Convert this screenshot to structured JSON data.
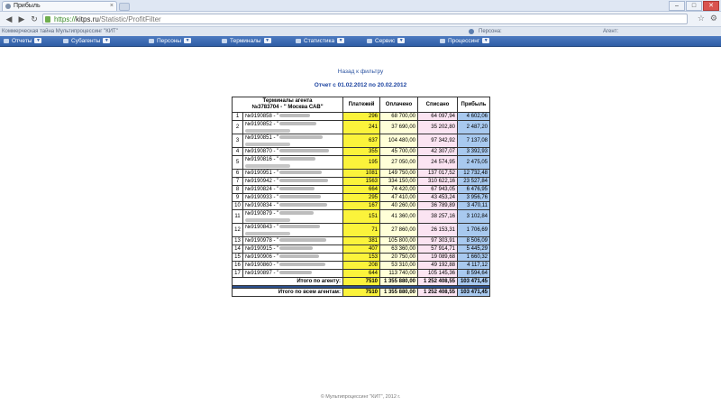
{
  "browser": {
    "tab_title": "Прибыль",
    "tab_close": "×",
    "url_scheme": "https://",
    "url_host": "kitps.ru",
    "url_path": "/Statistic/ProfitFilter",
    "window_minimize": "–",
    "window_maximize": "□",
    "window_close": "✕"
  },
  "site": {
    "company": "Коммерческая тайна Мультипроцессинг \"КИТ\"",
    "personal_label": "Персона:",
    "agent_label": "Агент:"
  },
  "menu": [
    {
      "label": "Отчеты",
      "icon": "report-icon"
    },
    {
      "label": "Субагенты",
      "icon": "subagents-icon"
    },
    {
      "label": "Персоны",
      "icon": "persons-icon"
    },
    {
      "label": "Терминалы",
      "icon": "terminals-icon"
    },
    {
      "label": "Статистика",
      "icon": "statistics-icon"
    },
    {
      "label": "Сервис",
      "icon": "service-icon"
    },
    {
      "label": "Процессинг",
      "icon": "processing-icon"
    }
  ],
  "page": {
    "back_link": "Назад к фильтру",
    "period": "Отчет с 01.02.2012 по 20.02.2012"
  },
  "report": {
    "header_terminals_line1": "Терминалы агента",
    "header_terminals_line2": "№3783704 - \" Москва САВ\"",
    "header_payments": "Платежей",
    "header_paid": "Оплачено",
    "header_written_off": "Списано",
    "header_profit": "Прибыль",
    "rows": [
      {
        "n": "1",
        "terminal": "№9190858 - \"",
        "payments": "296",
        "paid": "68 700,00",
        "written_off": "64 097,94",
        "profit": "4 602,06"
      },
      {
        "n": "2",
        "terminal": "№9190852 - \"",
        "payments": "241",
        "paid": "37 690,00",
        "written_off": "35 202,80",
        "profit": "2 487,20"
      },
      {
        "n": "3",
        "terminal": "№9190851 - \"",
        "payments": "637",
        "paid": "104 480,00",
        "written_off": "97 342,92",
        "profit": "7 137,08"
      },
      {
        "n": "4",
        "terminal": "№9190870 - \"",
        "payments": "355",
        "paid": "45 700,00",
        "written_off": "42 307,07",
        "profit": "3 392,93"
      },
      {
        "n": "5",
        "terminal": "№9190816 - \"",
        "payments": "195",
        "paid": "27 050,00",
        "written_off": "24 574,95",
        "profit": "2 475,05"
      },
      {
        "n": "6",
        "terminal": "№9190951 - \"",
        "payments": "1081",
        "paid": "149 750,00",
        "written_off": "137 017,52",
        "profit": "12 732,48"
      },
      {
        "n": "7",
        "terminal": "№9190942 - \"",
        "payments": "1563",
        "paid": "334 150,00",
        "written_off": "310 622,16",
        "profit": "23 527,84"
      },
      {
        "n": "8",
        "terminal": "№9190824 - \"",
        "payments": "664",
        "paid": "74 420,00",
        "written_off": "67 943,05",
        "profit": "6 476,95"
      },
      {
        "n": "9",
        "terminal": "№9190933 - \"",
        "payments": "295",
        "paid": "47 410,00",
        "written_off": "43 453,24",
        "profit": "3 956,76"
      },
      {
        "n": "10",
        "terminal": "№9190834 - \"",
        "payments": "167",
        "paid": "40 260,00",
        "written_off": "36 789,89",
        "profit": "3 470,11"
      },
      {
        "n": "11",
        "terminal": "№9190879 - \"",
        "payments": "151",
        "paid": "41 360,00",
        "written_off": "38 257,16",
        "profit": "3 102,84"
      },
      {
        "n": "12",
        "terminal": "№9190843 - \"",
        "payments": "71",
        "paid": "27 860,00",
        "written_off": "26 153,31",
        "profit": "1 706,69"
      },
      {
        "n": "13",
        "terminal": "№9190978 - \"",
        "payments": "381",
        "paid": "105 800,00",
        "written_off": "97 303,91",
        "profit": "8 506,09"
      },
      {
        "n": "14",
        "terminal": "№9190915 - \"",
        "payments": "407",
        "paid": "63 360,00",
        "written_off": "57 914,71",
        "profit": "5 445,29"
      },
      {
        "n": "15",
        "terminal": "№9190906 - \"",
        "payments": "153",
        "paid": "20 750,00",
        "written_off": "19 089,68",
        "profit": "1 660,32"
      },
      {
        "n": "16",
        "terminal": "№9190860 - \"",
        "payments": "208",
        "paid": "53 310,00",
        "written_off": "49 192,88",
        "profit": "4 117,12"
      },
      {
        "n": "17",
        "terminal": "№9190897 - \"",
        "payments": "644",
        "paid": "113 740,00",
        "written_off": "105 145,36",
        "profit": "8 594,64"
      }
    ],
    "total_agent_label": "Итого по агенту:",
    "total_agent": {
      "payments": "7510",
      "paid": "1 355 880,00",
      "written_off": "1 252 408,55",
      "profit": "103 471,45"
    },
    "total_all_label": "Итого по всем агентам:",
    "total_all": {
      "payments": "7510",
      "paid": "1 355 880,00",
      "written_off": "1 252 408,55",
      "profit": "103 471,45"
    }
  },
  "footer": "© Мультипроцессинг \"КИТ\", 2012 г."
}
